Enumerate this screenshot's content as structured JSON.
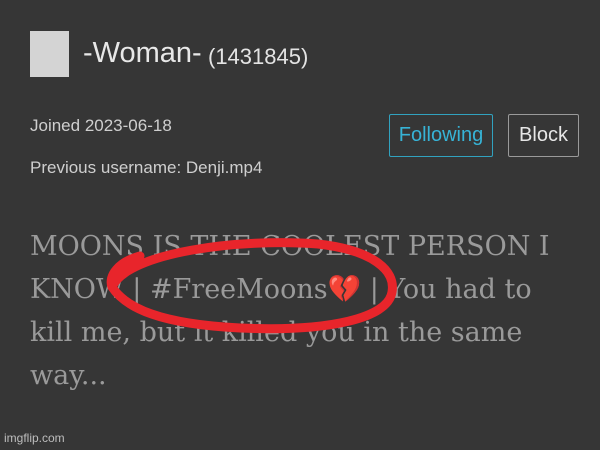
{
  "profile": {
    "username": "-Woman-",
    "user_id": "(1431845)",
    "joined": "Joined 2023-06-18",
    "previous_username": "Previous username: Denji.mp4"
  },
  "actions": {
    "following_label": "Following",
    "block_label": "Block"
  },
  "bio": {
    "line1": "MOONS IS THE COOLEST PERSON I",
    "line2": "KNOW | #FreeMoons💔 | You had to",
    "line3": "kill me, but it killed you in the same",
    "line4": "way..."
  },
  "annotation": {
    "color": "#e8252b"
  },
  "icons": {
    "avatar": "avatar-placeholder"
  },
  "colors": {
    "background": "#363636",
    "accent": "#37b3d6"
  },
  "watermark": "imgflip.com"
}
